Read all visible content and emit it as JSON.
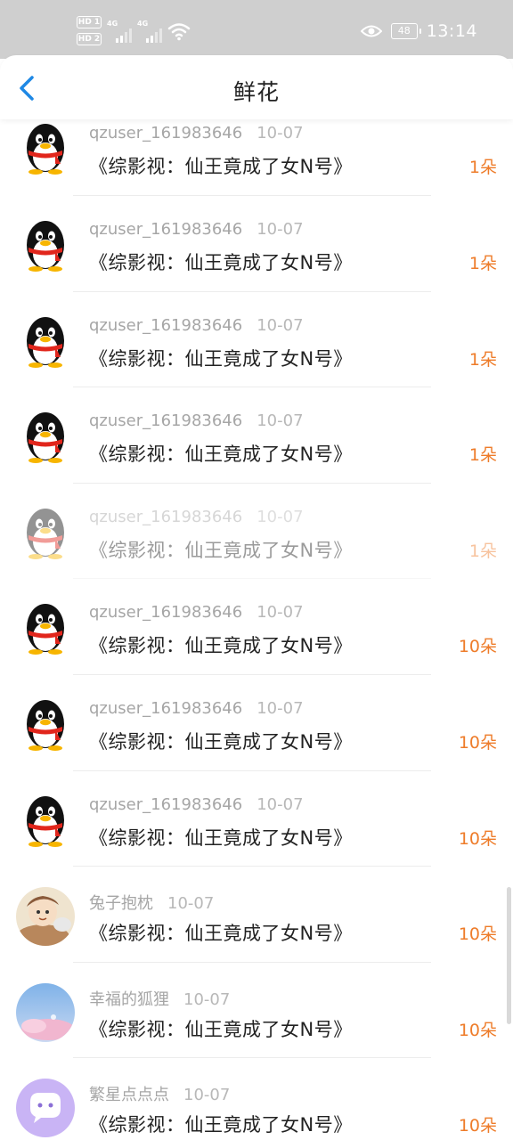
{
  "status_bar": {
    "sim1": "HD 1",
    "sim2": "HD 2",
    "net1": "4G",
    "net2": "4G",
    "battery": "48",
    "time": "13:14"
  },
  "header": {
    "title": "鲜花"
  },
  "colors": {
    "accent": "#1e88e5",
    "count": "#ee7c2a"
  },
  "items": [
    {
      "user": "qzuser_161983646",
      "date": "10-07",
      "work": "《综影视：仙王竟成了女N号》",
      "count": "1朵",
      "avatar": "penguin-icon"
    },
    {
      "user": "qzuser_161983646",
      "date": "10-07",
      "work": "《综影视：仙王竟成了女N号》",
      "count": "1朵",
      "avatar": "penguin-icon"
    },
    {
      "user": "qzuser_161983646",
      "date": "10-07",
      "work": "《综影视：仙王竟成了女N号》",
      "count": "1朵",
      "avatar": "penguin-icon"
    },
    {
      "user": "qzuser_161983646",
      "date": "10-07",
      "work": "《综影视：仙王竟成了女N号》",
      "count": "1朵",
      "avatar": "penguin-icon"
    },
    {
      "user": "qzuser_161983646",
      "date": "10-07",
      "work": "《综影视：仙王竟成了女N号》",
      "count": "1朵",
      "avatar": "penguin-icon"
    },
    {
      "user": "qzuser_161983646",
      "date": "10-07",
      "work": "《综影视：仙王竟成了女N号》",
      "count": "10朵",
      "avatar": "penguin-icon"
    },
    {
      "user": "qzuser_161983646",
      "date": "10-07",
      "work": "《综影视：仙王竟成了女N号》",
      "count": "10朵",
      "avatar": "penguin-icon"
    },
    {
      "user": "qzuser_161983646",
      "date": "10-07",
      "work": "《综影视：仙王竟成了女N号》",
      "count": "10朵",
      "avatar": "penguin-icon"
    },
    {
      "user": "兔子抱枕",
      "date": "10-07",
      "work": "《综影视：仙王竟成了女N号》",
      "count": "10朵",
      "avatar": "cartoon-avatar"
    },
    {
      "user": "幸福的狐狸",
      "date": "10-07",
      "work": "《综影视：仙王竟成了女N号》",
      "count": "10朵",
      "avatar": "sky-avatar"
    },
    {
      "user": "繁星点点点",
      "date": "10-07",
      "work": "《综影视：仙王竟成了女N号》",
      "count": "10朵",
      "avatar": "chat-bubble-avatar"
    }
  ]
}
